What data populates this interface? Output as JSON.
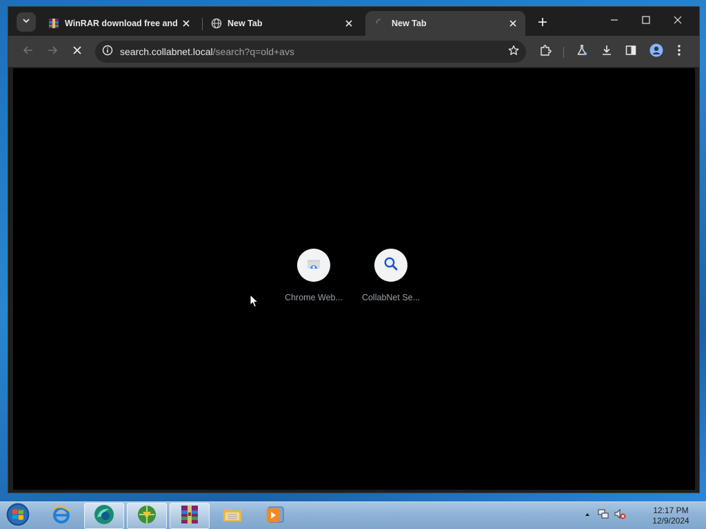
{
  "browser": {
    "tabs": [
      {
        "title": "WinRAR download free and support: WinRAR",
        "active": false,
        "favicon": "winrar-icon"
      },
      {
        "title": "New Tab",
        "active": false,
        "favicon": "globe-icon"
      },
      {
        "title": "New Tab",
        "active": true,
        "favicon": "loading-spinner-icon"
      }
    ],
    "address_bar": {
      "host": "search.collabnet.local",
      "path": "/search?q=old+avs"
    },
    "shortcuts": [
      {
        "label": "Chrome Web...",
        "icon": "chrome-web-store-icon"
      },
      {
        "label": "CollabNet Se...",
        "icon": "magnifier-icon"
      }
    ]
  },
  "taskbar": {
    "apps": [
      "internet-explorer-icon",
      "browser-app-icon",
      "download-manager-icon",
      "winrar-icon",
      "file-explorer-icon",
      "media-player-icon"
    ],
    "clock": {
      "time": "12:17 PM",
      "date": "12/9/2024"
    }
  },
  "colors": {
    "window_bg": "#1f1f1f",
    "toolbar_bg": "#3b3b3b",
    "content_bg": "#000000",
    "taskbar_accent": "#8fb3d6"
  }
}
